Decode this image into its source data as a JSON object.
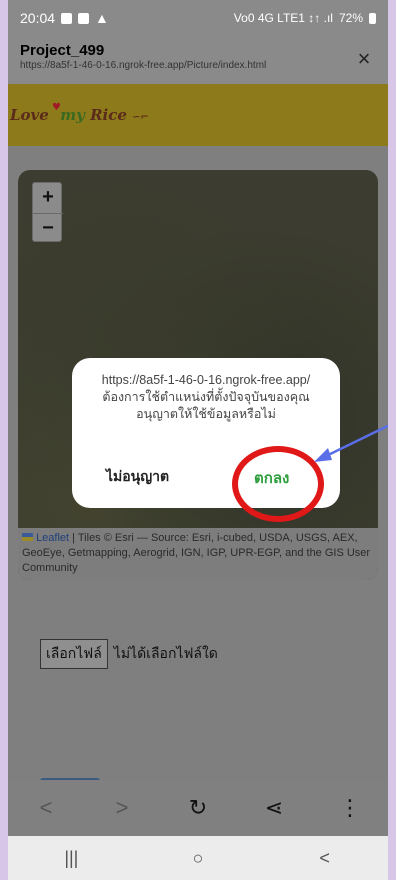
{
  "status_bar": {
    "time": "20:04",
    "right_text": "Vo0 4G LTE1 ↕↑ .ıl",
    "battery": "72%"
  },
  "title_bar": {
    "title": "Project_499",
    "url": "https://8a5f-1-46-0-16.ngrok-free.app/Picture/index.html",
    "close_label": "×"
  },
  "banner": {
    "logo_word1": "Love",
    "logo_word2": "my",
    "logo_word3": "Rice"
  },
  "map": {
    "zoom_in": "+",
    "zoom_out": "−",
    "attribution_leaflet": "Leaflet",
    "attribution_rest": " | Tiles © Esri — Source: Esri, i-cubed, USDA, USGS, AEX, GeoEye, Getmapping, Aerogrid, IGN, IGP, UPR-EGP, and the GIS User Community"
  },
  "file_input": {
    "button_label": "เลือกไฟล์",
    "status_text": "ไม่ได้เลือกไฟล์ใด"
  },
  "dialog": {
    "message": "https://8a5f-1-46-0-16.ngrok-free.app/ ต้องการใช้ตำแหน่งที่ตั้งปัจจุบันของคุณ อนุญาตให้ใช้ข้อมูลหรือไม่",
    "deny_label": "ไม่อนุญาต",
    "ok_label": "ตกลง"
  },
  "colors": {
    "ok_green": "#2e9e3e",
    "highlight_red": "#e01818",
    "arrow_blue": "#5a6ee8",
    "banner_yellow": "#e8c820"
  }
}
